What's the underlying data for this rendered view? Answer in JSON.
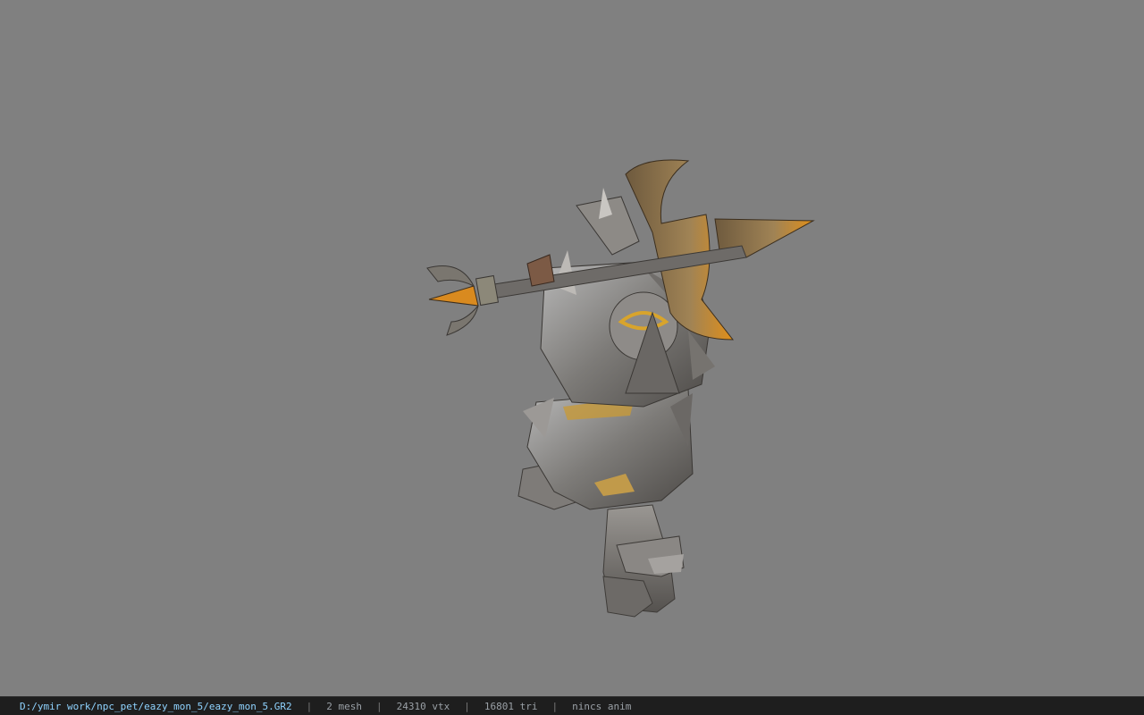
{
  "status": {
    "file_path": "D:/ymir work/npc_pet/eazy_mon_5/eazy_mon_5.GR2",
    "separator": "|",
    "mesh": "2 mesh",
    "vertices": "24310 vtx",
    "triangles": "16801 tri",
    "animation": "nincs anim"
  },
  "viewport": {
    "background_color": "#808080",
    "model_name": "eazy_mon_5"
  },
  "colors": {
    "statusbar_bg": "#1e1e1e",
    "path_text": "#8fd3ff",
    "stat_text": "#9aa0a6"
  }
}
